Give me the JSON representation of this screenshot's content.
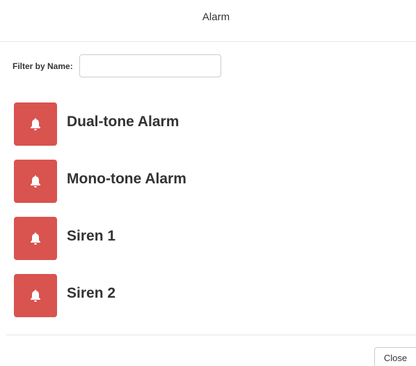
{
  "dialog": {
    "title": "Alarm"
  },
  "filter": {
    "label": "Filter by Name:",
    "value": "",
    "placeholder": ""
  },
  "items": [
    {
      "label": "Dual-tone Alarm",
      "icon": "bell-icon"
    },
    {
      "label": "Mono-tone Alarm",
      "icon": "bell-icon"
    },
    {
      "label": "Siren 1",
      "icon": "bell-icon"
    },
    {
      "label": "Siren 2",
      "icon": "bell-icon"
    }
  ],
  "footer": {
    "close_label": "Close"
  },
  "colors": {
    "icon_background": "#d9534f",
    "icon_foreground": "#ffffff"
  }
}
